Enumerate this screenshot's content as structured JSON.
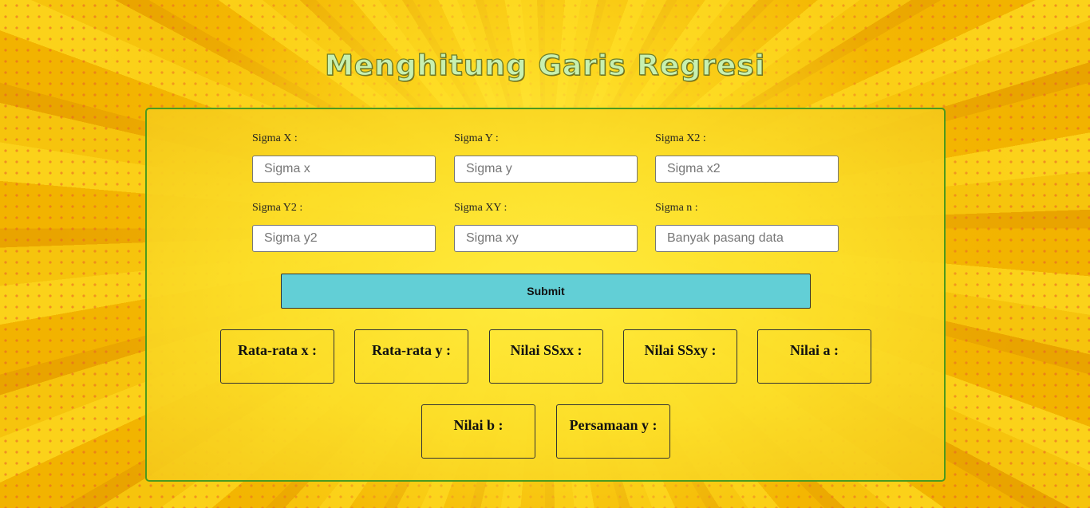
{
  "header": {
    "title": "Menghitung Garis Regresi"
  },
  "form": {
    "fields": [
      {
        "label": "Sigma X :",
        "placeholder": "Sigma x"
      },
      {
        "label": "Sigma Y :",
        "placeholder": "Sigma y"
      },
      {
        "label": "Sigma X2 :",
        "placeholder": "Sigma x2"
      },
      {
        "label": "Sigma Y2 :",
        "placeholder": "Sigma y2"
      },
      {
        "label": "Sigma XY :",
        "placeholder": "Sigma xy"
      },
      {
        "label": "Sigma n :",
        "placeholder": "Banyak pasang data"
      }
    ],
    "submit_label": "Submit"
  },
  "results": [
    {
      "label": "Rata-rata x :"
    },
    {
      "label": "Rata-rata y :"
    },
    {
      "label": "Nilai SSxx :"
    },
    {
      "label": "Nilai SSxy :"
    },
    {
      "label": "Nilai a :"
    },
    {
      "label": "Nilai b :"
    },
    {
      "label": "Persamaan y :"
    }
  ],
  "colors": {
    "background": "#f7c10a",
    "panel_border": "#4c9a1e",
    "submit_button": "#62cfd6",
    "title_fill": "#c8f0b0"
  }
}
